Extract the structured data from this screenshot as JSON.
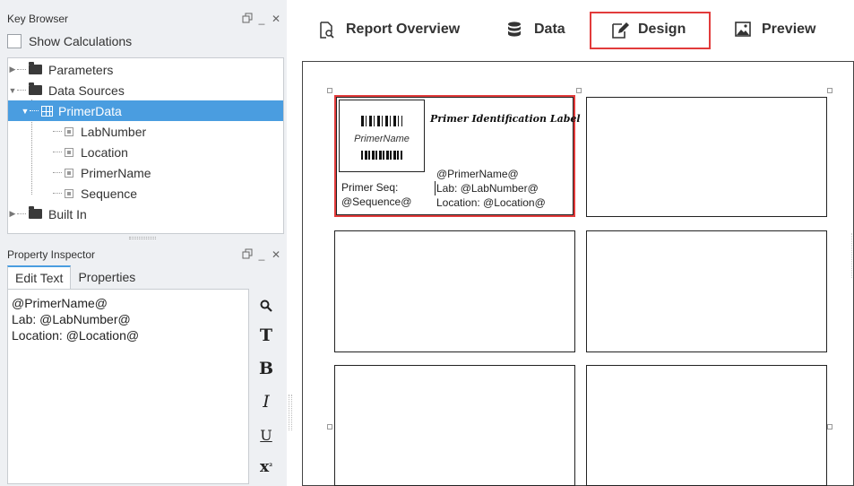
{
  "key_browser": {
    "title": "Key Browser",
    "show_calculations": "Show Calculations",
    "tree": {
      "parameters": "Parameters",
      "data_sources": "Data Sources",
      "primer_data": "PrimerData",
      "fields": [
        "LabNumber",
        "Location",
        "PrimerName",
        "Sequence"
      ],
      "built_in": "Built In"
    }
  },
  "property_inspector": {
    "title": "Property Inspector",
    "tabs": [
      "Edit Text",
      "Properties"
    ],
    "editor_lines": [
      "@PrimerName@",
      "Lab: @LabNumber@",
      "Location: @Location@"
    ],
    "format_buttons": [
      "search-icon",
      "T",
      "B",
      "I",
      "U",
      "x²"
    ]
  },
  "toolbar": {
    "tabs": [
      "Report Overview",
      "Data",
      "Design",
      "Preview"
    ],
    "active_tab": "Design",
    "highlight_color": "#e23b3b"
  },
  "label": {
    "qr_caption": "PrimerName",
    "title": "Primer Identification Label",
    "seq_line1": "Primer Seq:",
    "seq_line2": "@Sequence@",
    "name_line": "@PrimerName@",
    "lab_line": "Lab: @LabNumber@",
    "location_line": "Location: @Location@"
  },
  "colors": {
    "selection_blue": "#4a9de0",
    "panel_bg": "#eef0f3"
  }
}
